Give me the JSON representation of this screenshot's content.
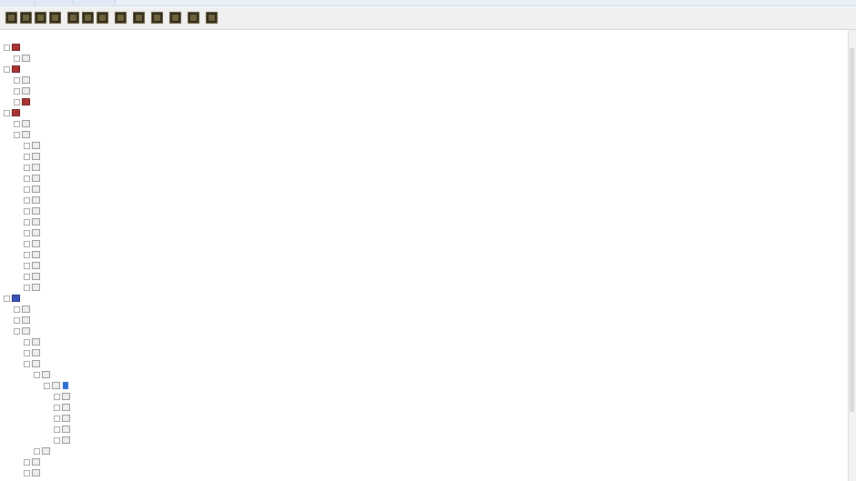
{
  "toolbar": {
    "buttons": [
      {
        "name": "tool-1-icon"
      },
      {
        "name": "tool-2-icon"
      },
      {
        "name": "tool-3-icon"
      },
      {
        "name": "tool-4-icon"
      },
      {
        "name": "tool-5-icon"
      },
      {
        "name": "tool-6-icon"
      },
      {
        "name": "tool-7-icon"
      },
      {
        "name": "tool-8-icon"
      },
      {
        "name": "tool-9-icon"
      },
      {
        "name": "tool-10-icon"
      },
      {
        "name": "tool-11-icon"
      },
      {
        "name": "tool-12-icon"
      },
      {
        "name": "tool-13-icon"
      }
    ]
  },
  "panel": {
    "title": ""
  },
  "tree": {
    "rows": [
      {
        "depth": 0,
        "icon": "red",
        "text": "",
        "sel": false
      },
      {
        "depth": 1,
        "icon": "grey",
        "text": "",
        "sel": false
      },
      {
        "depth": 0,
        "icon": "red",
        "text": "",
        "sel": false
      },
      {
        "depth": 1,
        "icon": "grey",
        "text": "",
        "sel": false
      },
      {
        "depth": 1,
        "icon": "grey",
        "text": "",
        "sel": false
      },
      {
        "depth": 1,
        "icon": "red",
        "text": "",
        "sel": false
      },
      {
        "depth": 0,
        "icon": "red",
        "text": "",
        "sel": false
      },
      {
        "depth": 1,
        "icon": "grey",
        "text": "",
        "sel": false
      },
      {
        "depth": 1,
        "icon": "grey",
        "text": "",
        "sel": false
      },
      {
        "depth": 2,
        "icon": "grey",
        "text": "",
        "sel": false
      },
      {
        "depth": 2,
        "icon": "grey",
        "text": "",
        "sel": false
      },
      {
        "depth": 2,
        "icon": "grey",
        "text": "",
        "sel": false
      },
      {
        "depth": 2,
        "icon": "grey",
        "text": "",
        "sel": false
      },
      {
        "depth": 2,
        "icon": "grey",
        "text": "",
        "sel": false
      },
      {
        "depth": 2,
        "icon": "grey",
        "text": "",
        "sel": false
      },
      {
        "depth": 2,
        "icon": "grey",
        "text": "",
        "sel": false
      },
      {
        "depth": 2,
        "icon": "grey",
        "text": "",
        "sel": false
      },
      {
        "depth": 2,
        "icon": "grey",
        "text": "",
        "sel": false
      },
      {
        "depth": 2,
        "icon": "grey",
        "text": "",
        "sel": false
      },
      {
        "depth": 2,
        "icon": "grey",
        "text": "",
        "sel": false
      },
      {
        "depth": 2,
        "icon": "grey",
        "text": "",
        "sel": false
      },
      {
        "depth": 2,
        "icon": "grey",
        "text": "",
        "sel": false
      },
      {
        "depth": 2,
        "icon": "grey",
        "text": "",
        "sel": false
      },
      {
        "depth": 0,
        "icon": "blue",
        "text": "",
        "sel": false
      },
      {
        "depth": 1,
        "icon": "grey",
        "text": "",
        "sel": false
      },
      {
        "depth": 1,
        "icon": "grey",
        "text": "",
        "sel": false
      },
      {
        "depth": 1,
        "icon": "grey",
        "text": "",
        "sel": false
      },
      {
        "depth": 2,
        "icon": "grey",
        "text": "",
        "sel": false
      },
      {
        "depth": 2,
        "icon": "grey",
        "text": "",
        "sel": false
      },
      {
        "depth": 2,
        "icon": "grey",
        "text": "",
        "sel": false
      },
      {
        "depth": 3,
        "icon": "grey",
        "text": "",
        "sel": false
      },
      {
        "depth": 4,
        "icon": "grey",
        "text": "",
        "sel": true
      },
      {
        "depth": 5,
        "icon": "grey",
        "text": "",
        "sel": false
      },
      {
        "depth": 5,
        "icon": "grey",
        "text": "",
        "sel": false
      },
      {
        "depth": 5,
        "icon": "grey",
        "text": "",
        "sel": false
      },
      {
        "depth": 5,
        "icon": "grey",
        "text": "",
        "sel": false
      },
      {
        "depth": 5,
        "icon": "grey",
        "text": "",
        "sel": false
      },
      {
        "depth": 3,
        "icon": "grey",
        "text": "",
        "sel": false
      },
      {
        "depth": 2,
        "icon": "grey",
        "text": "",
        "sel": false
      },
      {
        "depth": 2,
        "icon": "grey",
        "text": "",
        "sel": false
      }
    ]
  }
}
